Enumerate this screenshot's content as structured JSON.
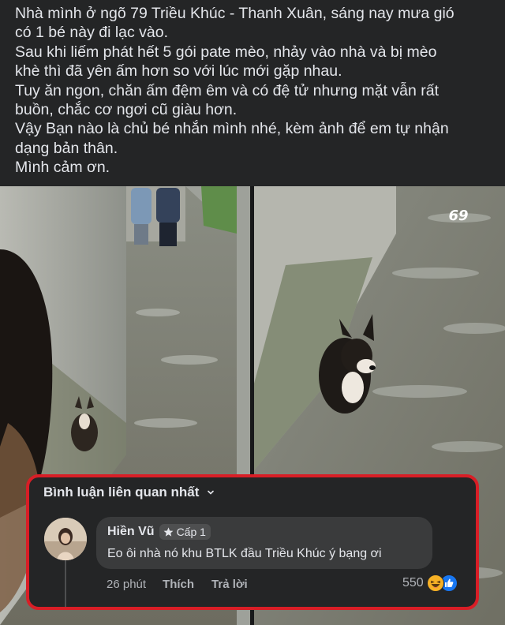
{
  "post": {
    "text": "Nhà mình ở ngõ 79 Triều Khúc - Thanh Xuân, sáng nay mưa gió\ncó 1 bé này đi lạc vào.\nSau khi liếm phát hết 5 gói pate mèo, nhảy vào nhà và bị mèo\nkhè thì đã yên ấm hơn so với lúc mới gặp nhau.\nTuy ăn ngon, chăn ấm đệm êm và có đệ tử nhưng mặt vẫn rất\nbuồn, chắc cơ ngơi cũ giàu hơn.\nVậy Bạn nào là chủ bé nhắn mình nhé, kèm ảnh để em tự nhận\ndạng bản thân.\nMình cảm ơn."
  },
  "photos": {
    "watermark": "69"
  },
  "comments": {
    "header": "Bình luận liên quan nhất",
    "top_comment": {
      "author": "Hiền Vũ",
      "badge": "Cấp 1",
      "text": "Eo ôi nhà nó khu BTLK đầu Triều Khúc ý bạng ơi",
      "time": "26 phút",
      "like_label": "Thích",
      "reply_label": "Trả lời",
      "reaction_count": "550"
    }
  },
  "icons": {
    "chevron": "chevron-down-icon",
    "badge": "star-badge-icon",
    "haha": "haha-reaction-icon",
    "like": "like-reaction-icon"
  },
  "colors": {
    "background": "#242526",
    "highlight_border": "#d81e26",
    "bubble": "#3a3b3c",
    "like_blue": "#1877f2",
    "haha_yellow": "#f7b125"
  }
}
